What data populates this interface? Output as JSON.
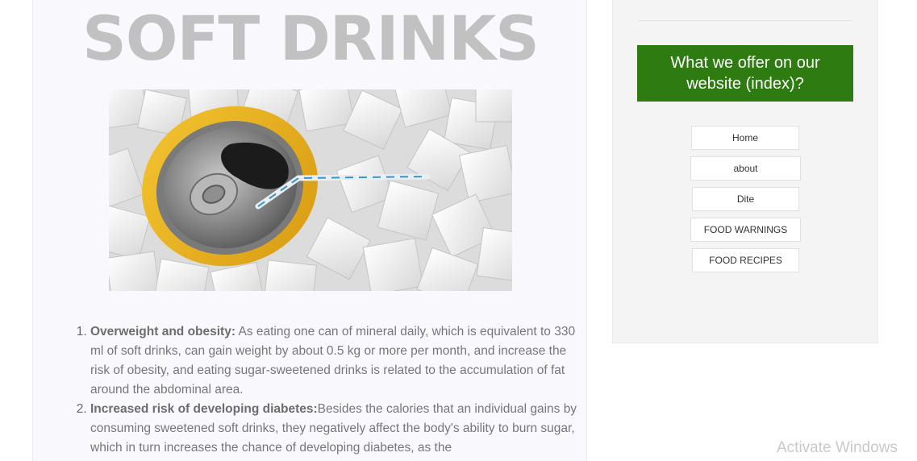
{
  "main": {
    "title": "SOFT DRINKS",
    "hero_image": "soda-can-sugar-cubes",
    "list": [
      {
        "heading": "Overweight and obesity:",
        "text": " As eating one can of mineral daily, which is equivalent to 330 ml of soft drinks, can gain weight by about 0.5 kg or more per month, and increase the risk of obesity, and eating sugar-sweetened drinks is related to the accumulation of fat around the abdominal area."
      },
      {
        "heading": "Increased risk of developing diabetes:",
        "text": "Besides the calories that an individual gains by consuming sweetened soft drinks, they negatively affect the body's ability to burn sugar, which in turn increases the chance of developing diabetes, as the"
      }
    ]
  },
  "sidebar": {
    "offer_title": "What we offer on our website (index)?",
    "offer_color": "#2e7b12",
    "nav": [
      {
        "label": "Home"
      },
      {
        "label": "about"
      },
      {
        "label": "Dite"
      },
      {
        "label": "FOOD WARNINGS"
      },
      {
        "label": "FOOD RECIPES"
      }
    ]
  },
  "watermark": "Activate Windows"
}
